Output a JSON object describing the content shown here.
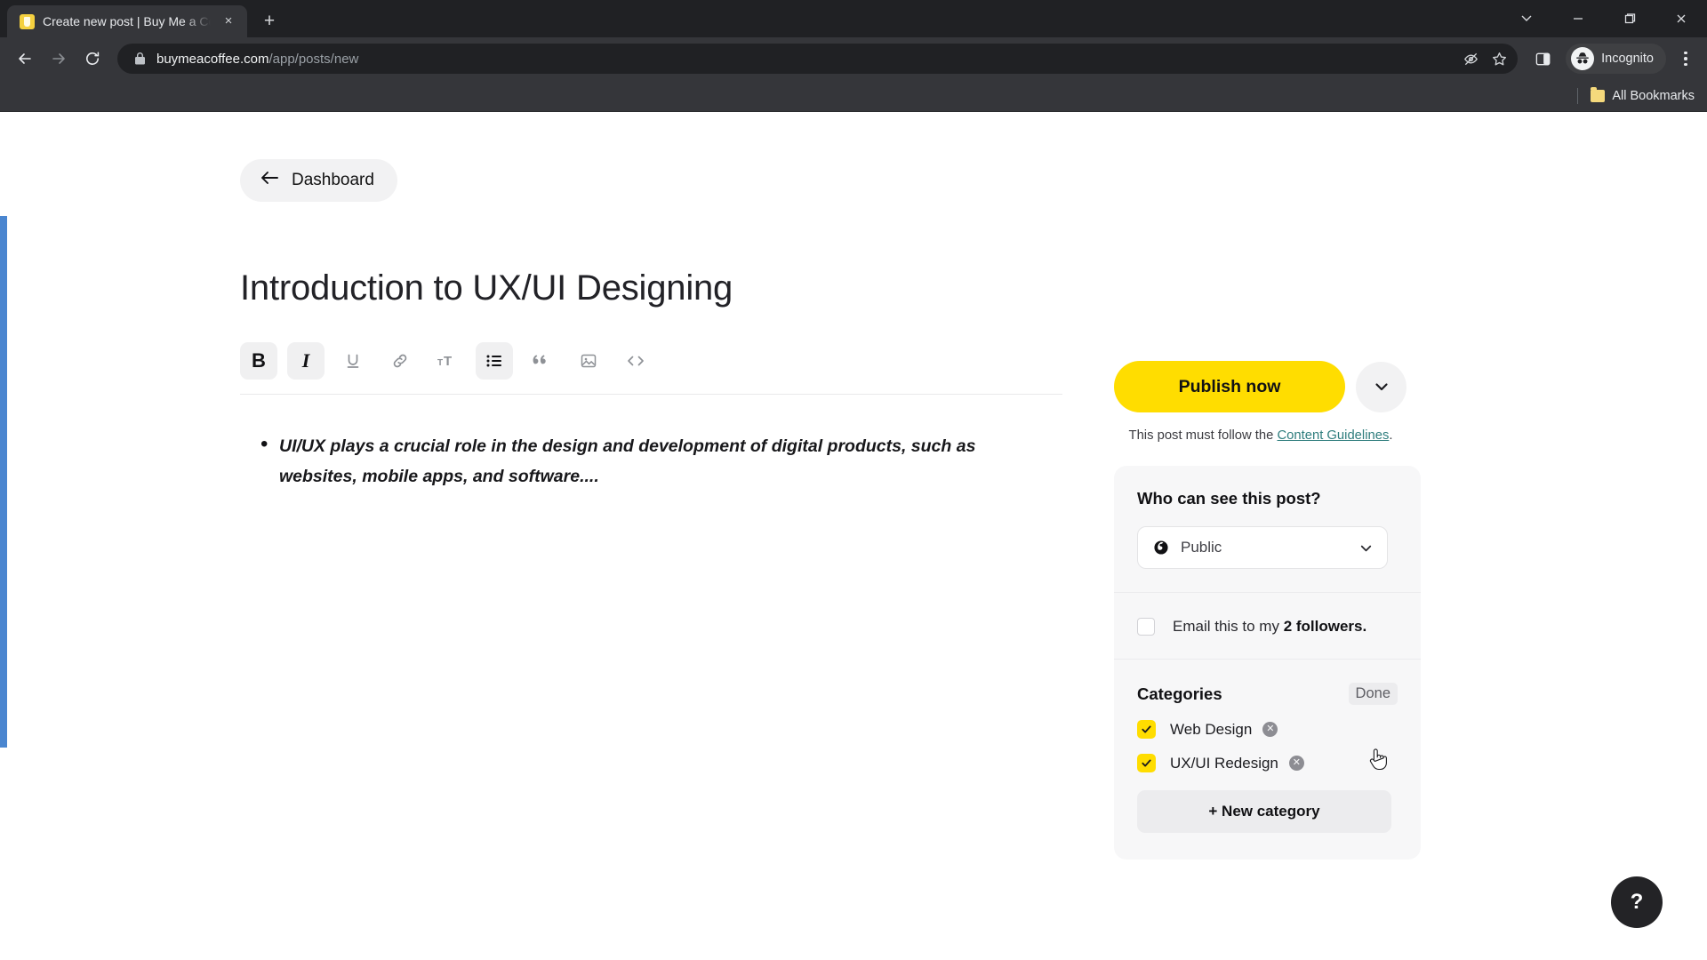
{
  "browser": {
    "tab": {
      "title": "Create new post | Buy Me a Coff",
      "favicon": "coffee-cup-icon",
      "close": "×"
    },
    "new_tab_label": "+",
    "window_controls": {
      "minimize": "minimize-icon",
      "maximize": "maximize-icon",
      "close": "close-icon",
      "tab_search": "tab-search-icon"
    },
    "nav": {
      "back": "back-arrow-icon",
      "forward": "forward-arrow-icon",
      "reload": "reload-icon"
    },
    "omnibox": {
      "lock": "lock-icon",
      "url_host": "buymeacoffee.com",
      "url_path": "/app/posts/new"
    },
    "omnibox_actions": {
      "tracking": "eye-off-icon",
      "bookmark": "star-icon"
    },
    "side_panel": "side-panel-icon",
    "profile": {
      "label": "Incognito",
      "icon": "incognito-icon"
    },
    "menu": "three-dot-menu-icon",
    "bookmarks": {
      "all_label": "All Bookmarks",
      "folder_icon": "folder-icon"
    }
  },
  "page": {
    "back_nav": {
      "label": "Dashboard",
      "icon": "arrow-left-icon"
    },
    "editor": {
      "title": "Introduction to UX/UI Designing",
      "toolbar": [
        {
          "name": "bold",
          "glyph": "B",
          "active": true
        },
        {
          "name": "italic",
          "glyph": "I",
          "active": true
        },
        {
          "name": "underline",
          "glyph": "U",
          "active": false
        },
        {
          "name": "link",
          "glyph": "🔗",
          "active": false
        },
        {
          "name": "heading",
          "glyph": "тT",
          "active": false
        },
        {
          "name": "bullet-list",
          "glyph": "☰",
          "active": true
        },
        {
          "name": "quote",
          "glyph": "”",
          "active": false
        },
        {
          "name": "image",
          "glyph": "Ὓc",
          "active": false
        },
        {
          "name": "code",
          "glyph": "<>",
          "active": false
        }
      ],
      "body_bullets": [
        "UI/UX plays a crucial role in the design and development of digital products, such as websites, mobile apps, and software...."
      ]
    },
    "sidebar": {
      "publish_label": "Publish now",
      "publish_caret": "chevron-down-icon",
      "guideline_prefix": "This post must follow the ",
      "guideline_link": "Content Guidelines",
      "guideline_suffix": ".",
      "visibility": {
        "heading": "Who can see this post?",
        "selected": "Public",
        "icon": "globe-icon",
        "caret": "chevron-down-icon"
      },
      "email": {
        "checked": false,
        "text_prefix": "Email this to my ",
        "text_strong": "2 followers."
      },
      "categories": {
        "heading": "Categories",
        "done_label": "Done",
        "items": [
          {
            "label": "Web Design",
            "checked": true,
            "remove": "remove-icon"
          },
          {
            "label": "UX/UI Redesign",
            "checked": true,
            "remove": "remove-icon"
          }
        ],
        "new_label": "+ New category"
      }
    },
    "help_label": "?"
  },
  "colors": {
    "brand_yellow": "#ffdd00",
    "chrome_dark": "#35363a",
    "omnibox_dark": "#202124",
    "focus_blue": "#4a86d0",
    "link_teal": "#2e7d7d",
    "panel_gray": "#f7f7f8"
  }
}
